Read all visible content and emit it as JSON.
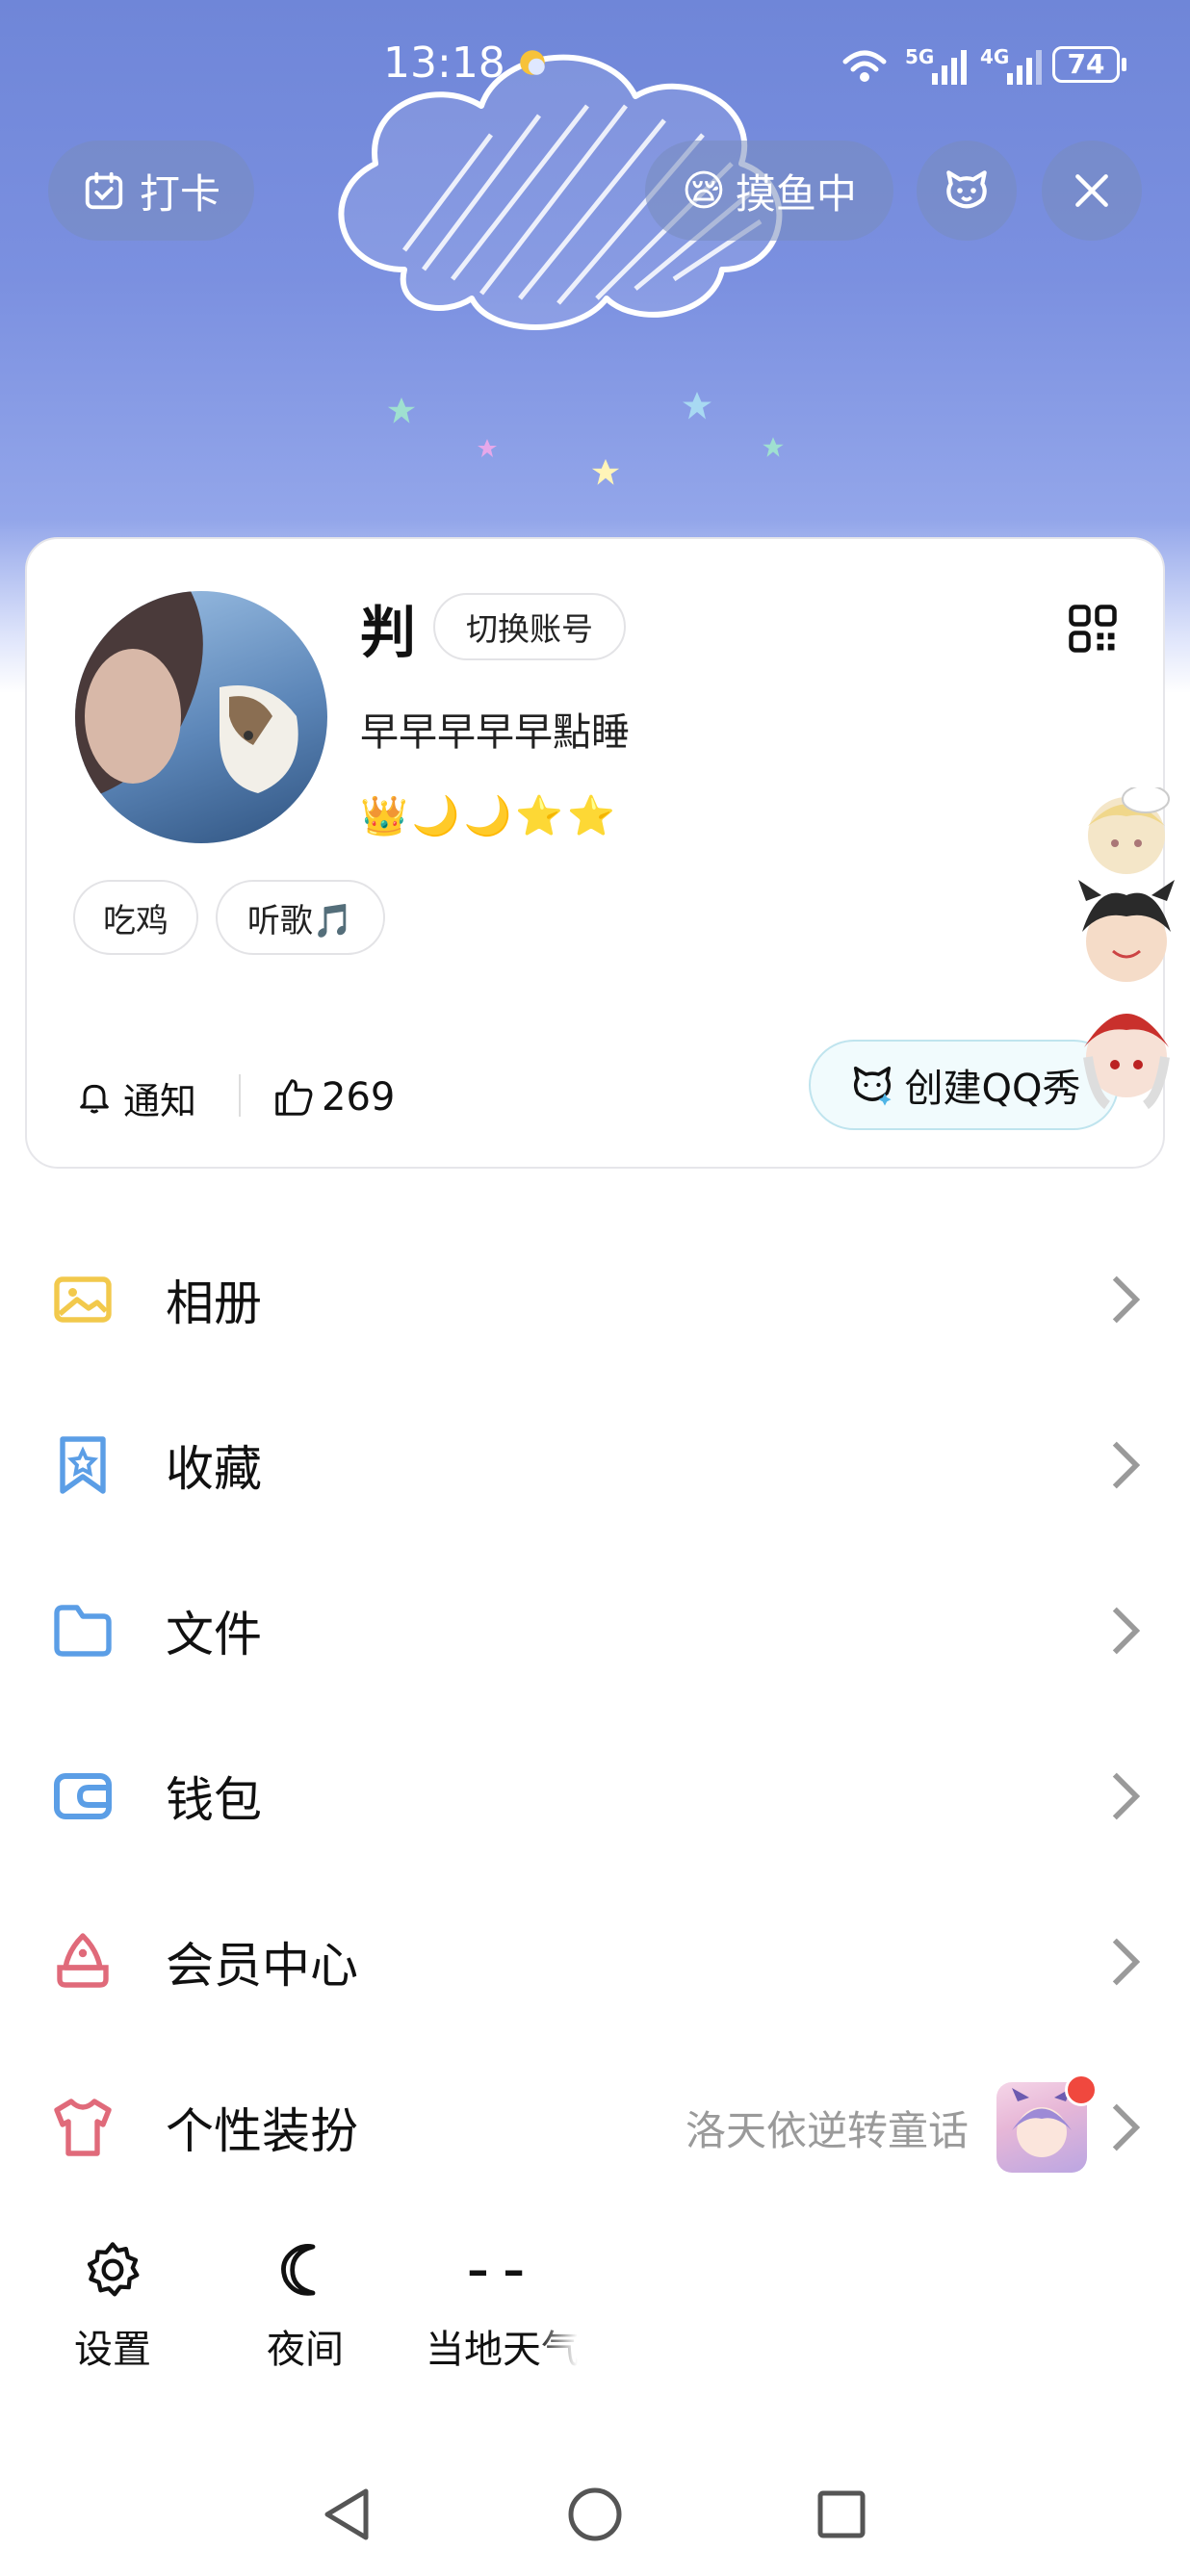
{
  "status_bar": {
    "time": "13:18",
    "battery": "74",
    "network_1": "5G",
    "network_2": "4G"
  },
  "top_actions": {
    "checkin_label": "打卡",
    "mood_label": "摸鱼中"
  },
  "profile": {
    "nickname": "判",
    "switch_account_label": "切换账号",
    "signature": "早早早早早點睡",
    "level_icons": "👑🌙🌙⭐⭐",
    "tags": [
      "吃鸡",
      "听歌🎵"
    ],
    "notify_label": "通知",
    "likes": "269",
    "qq_show_label": "创建QQ秀"
  },
  "menu": [
    {
      "label": "相册",
      "icon": "album-icon"
    },
    {
      "label": "收藏",
      "icon": "favorites-icon"
    },
    {
      "label": "文件",
      "icon": "folder-icon"
    },
    {
      "label": "钱包",
      "icon": "wallet-icon"
    },
    {
      "label": "会员中心",
      "icon": "vip-icon"
    },
    {
      "label": "个性装扮",
      "icon": "tshirt-icon",
      "right_text": "洛天依逆转童话"
    }
  ],
  "bottom_tools": [
    {
      "label": "设置",
      "icon": "gear-icon"
    },
    {
      "label": "夜间",
      "icon": "moon-icon"
    },
    {
      "label": "当地天气",
      "value": "– –"
    }
  ],
  "colors": {
    "accent_blue": "#5b9ee6",
    "album_yellow": "#f2c94c",
    "vip_red": "#e06a7a",
    "hero_blue": "#7b90e0"
  }
}
